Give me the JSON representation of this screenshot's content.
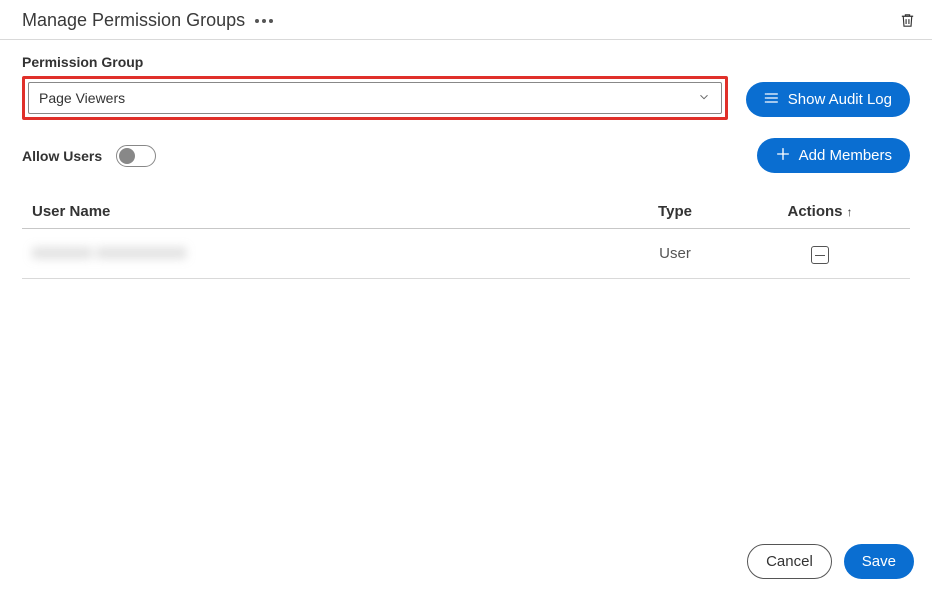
{
  "header": {
    "title": "Manage Permission Groups"
  },
  "fields": {
    "permission_group_label": "Permission Group",
    "permission_group_value": "Page Viewers",
    "allow_users_label": "Allow Users"
  },
  "buttons": {
    "show_audit_log": "Show Audit Log",
    "add_members": "Add Members",
    "cancel": "Cancel",
    "save": "Save"
  },
  "table": {
    "headers": {
      "user_name": "User Name",
      "type": "Type",
      "actions": "Actions"
    },
    "rows": [
      {
        "name": "XXXXXX XXXXXXXXX",
        "type": "User"
      }
    ]
  }
}
